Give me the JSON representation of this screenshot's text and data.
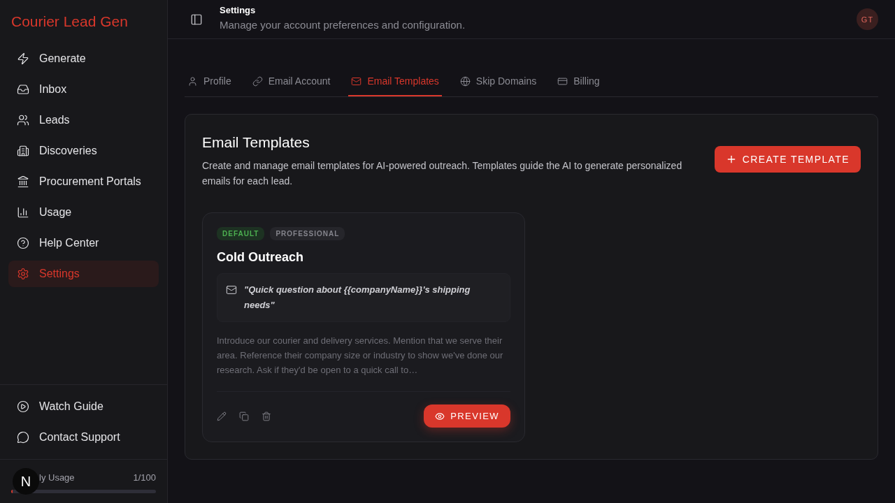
{
  "sidebar": {
    "brand": "Courier Lead Gen",
    "items": [
      {
        "label": "Generate",
        "selected": false
      },
      {
        "label": "Inbox",
        "selected": false
      },
      {
        "label": "Leads",
        "selected": false
      },
      {
        "label": "Discoveries",
        "selected": false
      },
      {
        "label": "Procurement Portals",
        "selected": false
      },
      {
        "label": "Usage",
        "selected": false
      },
      {
        "label": "Help Center",
        "selected": false
      },
      {
        "label": "Settings",
        "selected": true
      }
    ],
    "footer_items": [
      {
        "label": "Watch Guide"
      },
      {
        "label": "Contact Support"
      }
    ],
    "usage": {
      "badge": "N",
      "label": "ly Usage",
      "count": "1/100",
      "level": 0.01
    }
  },
  "header": {
    "title": "Settings",
    "subtitle": "Manage your account preferences and configuration.",
    "avatar": "GT"
  },
  "tabs": [
    {
      "label": "Profile",
      "selected": false
    },
    {
      "label": "Email Account",
      "selected": false
    },
    {
      "label": "Email Templates",
      "selected": true
    },
    {
      "label": "Skip Domains",
      "selected": false
    },
    {
      "label": "Billing",
      "selected": false
    }
  ],
  "panel": {
    "title": "Email Templates",
    "description": "Create and manage email templates for AI-powered outreach. Templates guide the AI to generate personalized emails for each lead.",
    "create_button": "CREATE TEMPLATE",
    "templates": [
      {
        "tags": [
          {
            "kind": "default",
            "label": "DEFAULT"
          },
          {
            "kind": "category",
            "label": "PROFESSIONAL"
          }
        ],
        "name": "Cold Outreach",
        "subject": "\"Quick question about {{companyName}}'s shipping needs\"",
        "body": "Introduce our courier and delivery services. Mention that we serve their area. Reference their company size or industry to show we've done our research. Ask if they'd be open to a quick call to…",
        "preview_button": "PREVIEW"
      }
    ]
  }
}
